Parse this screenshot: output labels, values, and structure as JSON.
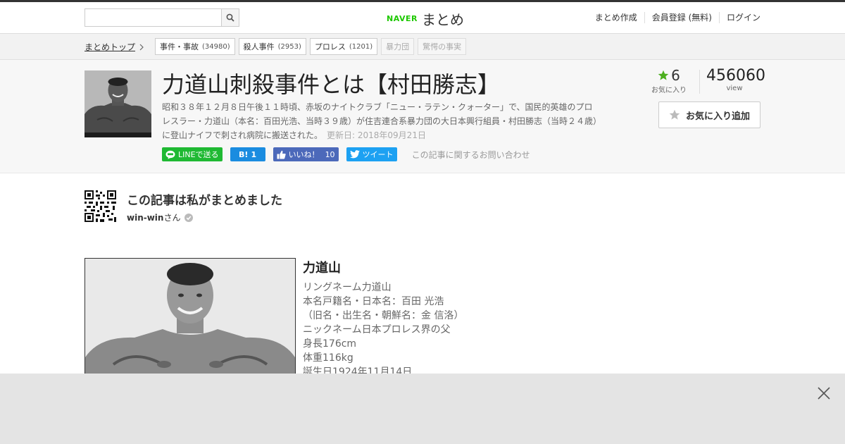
{
  "topbar": {
    "logo_brand": "NAVER",
    "logo_name": "まとめ",
    "nav": [
      "まとめ作成",
      "会員登録 (無料)",
      "ログイン"
    ]
  },
  "breadcrumb": {
    "top_label": "まとめトップ",
    "tags": [
      {
        "label": "事件・事故",
        "count": "(34980)"
      },
      {
        "label": "殺人事件",
        "count": "(2953)"
      },
      {
        "label": "プロレス",
        "count": "(1201)"
      },
      {
        "label": "暴力団",
        "count": ""
      },
      {
        "label": "驚愕の事実",
        "count": ""
      }
    ]
  },
  "article": {
    "title": "力道山刺殺事件とは【村田勝志】",
    "description": "昭和３８年１２月８日午後１１時頃、赤坂のナイトクラブ「ニュー・ラテン・クォーター」で、国民的英雄のプロレスラー・力道山（本名：百田光浩、当時３９歳）が住吉連合系暴力団の大日本興行組員・村田勝志（当時２４歳）に登山ナイフで刺され病院に搬送された。",
    "updated": "更新日: 2018年09月21日",
    "favorites": "6",
    "favorites_label": "お気に入り",
    "views": "456060",
    "views_label": "view",
    "fav_button": "お気に入り追加",
    "contact": "この記事に関するお問い合わせ"
  },
  "share": {
    "line": "LINEで送る",
    "hatena_count": "1",
    "like_label": "いいね！",
    "like_count": "10",
    "tweet": "ツイート"
  },
  "author": {
    "heading": "この記事は私がまとめました",
    "name": "win-win",
    "suffix": "さん"
  },
  "profile": {
    "name": "力道山",
    "lines": [
      "リングネーム力道山",
      "本名戸籍名・日本名：百田 光浩",
      "（旧名・出生名・朝鮮名：金 信洛）",
      "ニックネーム日本プロレス界の父",
      "身長176cm",
      "体重116kg",
      "誕生日1924年11月14日"
    ]
  },
  "colors": {
    "naver_green": "#1ec800",
    "line_green": "#1fb933",
    "hatena_blue": "#1a8ce0",
    "facebook_blue": "#4c69ba",
    "twitter_blue": "#1da1f2"
  }
}
